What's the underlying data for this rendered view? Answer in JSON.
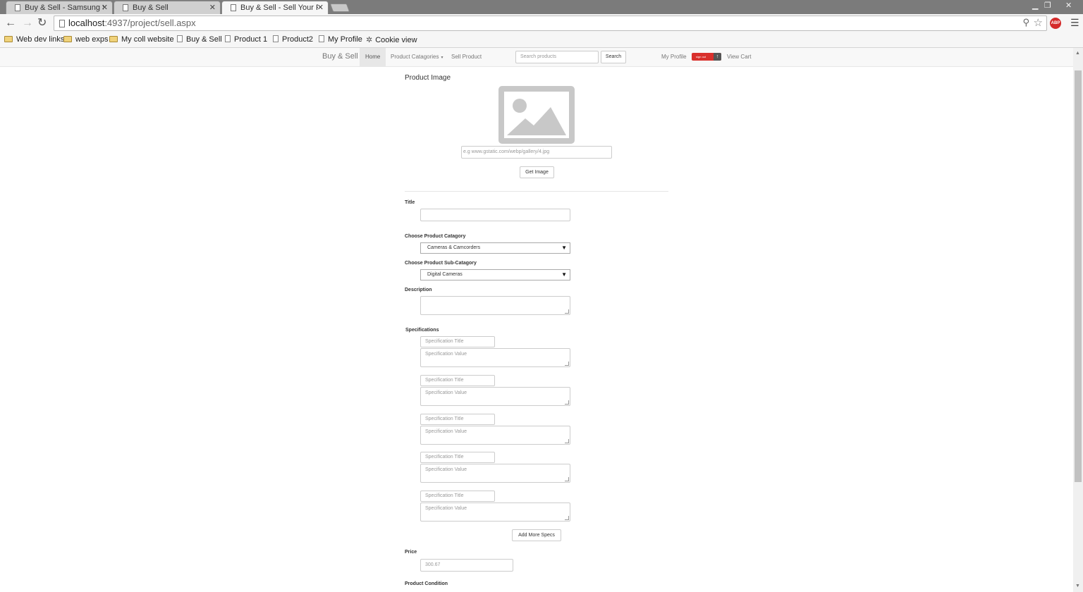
{
  "browser": {
    "tabs": [
      {
        "title": "Buy & Sell - Samsung Sm"
      },
      {
        "title": "Buy & Sell"
      },
      {
        "title": "Buy & Sell - Sell Your Proc"
      }
    ],
    "url_host": "localhost",
    "url_rest": ":4937/project/sell.aspx",
    "abp_label": "ABP",
    "bookmarks": [
      {
        "label": "Web dev links",
        "icon": "folder-icon"
      },
      {
        "label": "web exps",
        "icon": "folder-icon"
      },
      {
        "label": "My coll website",
        "icon": "folder-icon"
      },
      {
        "label": "Buy & Sell",
        "icon": "page-icon"
      },
      {
        "label": "Product 1",
        "icon": "page-icon"
      },
      {
        "label": "Product2",
        "icon": "page-icon"
      },
      {
        "label": "My Profile",
        "icon": "page-icon"
      },
      {
        "label": "Cookie view",
        "icon": "gear-icon"
      }
    ]
  },
  "site_nav": {
    "brand": "Buy & Sell",
    "home": "Home",
    "categories": "Product Catagories",
    "sell": "Sell Product",
    "search_placeholder": "Search products",
    "search_button": "Search",
    "my_profile": "My Profile",
    "sign_out": "sign out",
    "view_cart": "View Cart"
  },
  "form": {
    "image_heading": "Product Image",
    "image_url_placeholder": "e.g www.gstatic.com/webp/gallery/4.jpg",
    "get_image": "Get Image",
    "title_label": "Title",
    "category_label": "Choose Product Catagory",
    "category_value": "Cameras & Camcorders",
    "subcategory_label": "Choose Product Sub-Catagory",
    "subcategory_value": "Digital Cameras",
    "description_label": "Description",
    "specifications_label": "Specifications",
    "spec_title_placeholder": "Specification Title",
    "spec_value_placeholder": "Specification Value",
    "add_more_specs": "Add More Specs",
    "price_label": "Price",
    "price_placeholder": "300.67",
    "condition_label": "Product Condition"
  },
  "colors": {
    "signout_red": "#d9302c",
    "abp_red": "#d42b2b"
  }
}
